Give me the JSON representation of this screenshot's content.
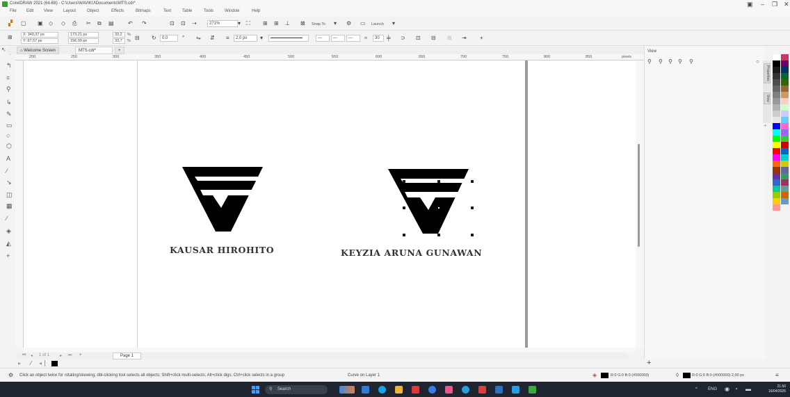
{
  "window": {
    "title": "CorelDRAW 2021 (64-Bit) - C:\\Users\\WAVIKU\\Documents\\MTS.cdr*",
    "controls": [
      "restore",
      "minimize",
      "maximize",
      "close"
    ]
  },
  "menu": [
    "File",
    "Edit",
    "View",
    "Layout",
    "Object",
    "Effects",
    "Bitmaps",
    "Text",
    "Table",
    "Tools",
    "Window",
    "Help"
  ],
  "toolbar": {
    "zoom": "271%",
    "snap_to": "Snap To",
    "launch": "Launch"
  },
  "properties": {
    "x": "X: 340,37 px",
    "y": "Y: 97,57 px",
    "width": "173,21 px",
    "height": "156,09 px",
    "scale_x": "33,2",
    "scale_y": "33,7",
    "pct": "%",
    "rotation": "0,0",
    "outline_width": "2,0 px",
    "smoothing": "30"
  },
  "tabs": {
    "welcome": "Welcome Screen",
    "document": "MTS.cdr*",
    "add": "+"
  },
  "ruler": {
    "unit": "pixels",
    "h_ticks": [
      "200",
      "250",
      "300",
      "350",
      "400",
      "450",
      "500",
      "550",
      "600",
      "650",
      "700",
      "750",
      "800",
      "850",
      "900"
    ]
  },
  "canvas": {
    "left_caption": "KAUSAR HIROHITO",
    "right_caption": "KEYZIA ARUNA GUNAWAN"
  },
  "docker": {
    "title": "View",
    "tabs": [
      "Properties",
      "View"
    ],
    "plus": "+"
  },
  "page_nav": {
    "page_of": "1 of 1",
    "page_tab": "Page 1"
  },
  "status": {
    "hint": "Click an object twice for rotating/skewing; dbl-clicking tool selects all objects; Shift+click multi-selects; Alt+click digs; Ctrl+click selects in a group",
    "object": "Curve on Layer 1",
    "fill": "R:0 G:0 B:0 (#000000)",
    "outline": "R:0 G:0 B:0 (#000000)  2,00 px"
  },
  "taskbar": {
    "search": "Search",
    "lang": "ENG",
    "time": "21.50",
    "date": "16/04/2025"
  },
  "palette": [
    "#ffffff",
    "#000000",
    "#1a1a1a",
    "#333333",
    "#4d4d4d",
    "#666666",
    "#808080",
    "#999999",
    "#b3b3b3",
    "#cccccc",
    "#e6e6e6",
    "#0000ff",
    "#00ffff",
    "#00ff00",
    "#ffff00",
    "#ff0000",
    "#ff00ff",
    "#ff6600",
    "#993300",
    "#663399",
    "#3366cc",
    "#00cc99",
    "#99cc00",
    "#ffcc00",
    "#ff9999",
    "#cc3366",
    "#660066",
    "#003366",
    "#006633",
    "#336600",
    "#996633",
    "#cc9966",
    "#ffcccc",
    "#ccffcc",
    "#ccccff",
    "#66ccff",
    "#ff66cc",
    "#9966ff",
    "#33cc33",
    "#cc0000",
    "#0066cc",
    "#00cccc",
    "#cccc00",
    "#666699",
    "#339966",
    "#993366",
    "#669999",
    "#cc6600",
    "#6699cc"
  ]
}
